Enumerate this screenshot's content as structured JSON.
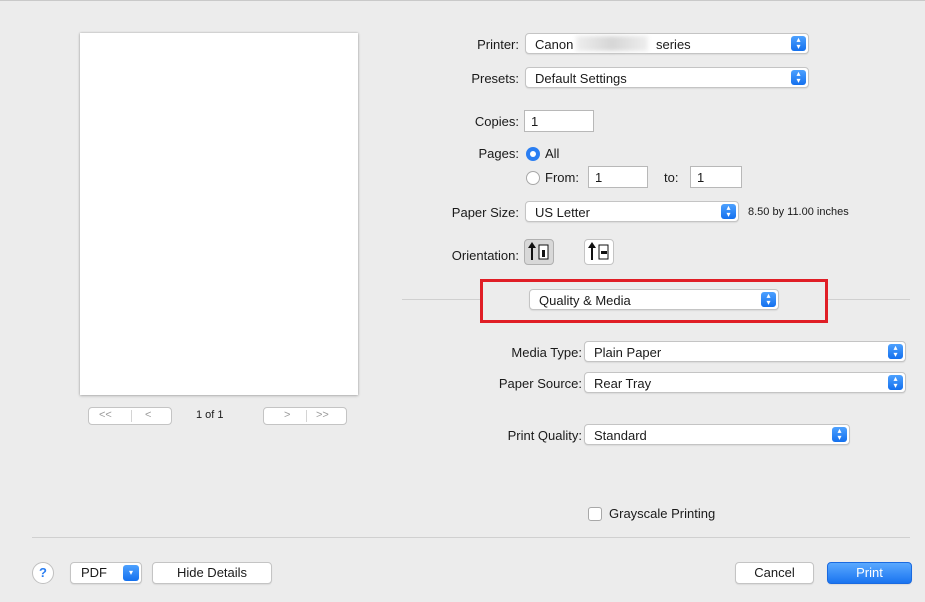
{
  "preview": {
    "page_indicator": "1 of 1"
  },
  "printer": {
    "label": "Printer:",
    "value_prefix": "Canon",
    "value_suffix": "series"
  },
  "presets": {
    "label": "Presets:",
    "value": "Default Settings"
  },
  "copies": {
    "label": "Copies:",
    "value": "1"
  },
  "pages": {
    "label": "Pages:",
    "all_label": "All",
    "from_label": "From:",
    "from_value": "1",
    "to_label": "to:",
    "to_value": "1",
    "selected": "All"
  },
  "paper_size": {
    "label": "Paper Size:",
    "value": "US Letter",
    "dimensions": "8.50 by 11.00 inches"
  },
  "orientation": {
    "label": "Orientation:",
    "selected": "portrait"
  },
  "section_menu": {
    "value": "Quality & Media"
  },
  "media_type": {
    "label": "Media Type:",
    "value": "Plain Paper"
  },
  "paper_source": {
    "label": "Paper Source:",
    "value": "Rear Tray"
  },
  "print_quality": {
    "label": "Print Quality:",
    "value": "Standard"
  },
  "grayscale": {
    "label": "Grayscale Printing",
    "checked": false
  },
  "footer": {
    "help": "?",
    "pdf_label": "PDF",
    "hide_details_label": "Hide Details",
    "cancel_label": "Cancel",
    "print_label": "Print"
  },
  "colors": {
    "accent": "#1a74f0",
    "highlight": "#e01e26"
  },
  "icons": [
    "chevron-up-down-icon",
    "first-page-icon",
    "prev-page-icon",
    "next-page-icon",
    "last-page-icon",
    "portrait-icon",
    "landscape-icon",
    "help-icon",
    "chevron-down-icon"
  ]
}
